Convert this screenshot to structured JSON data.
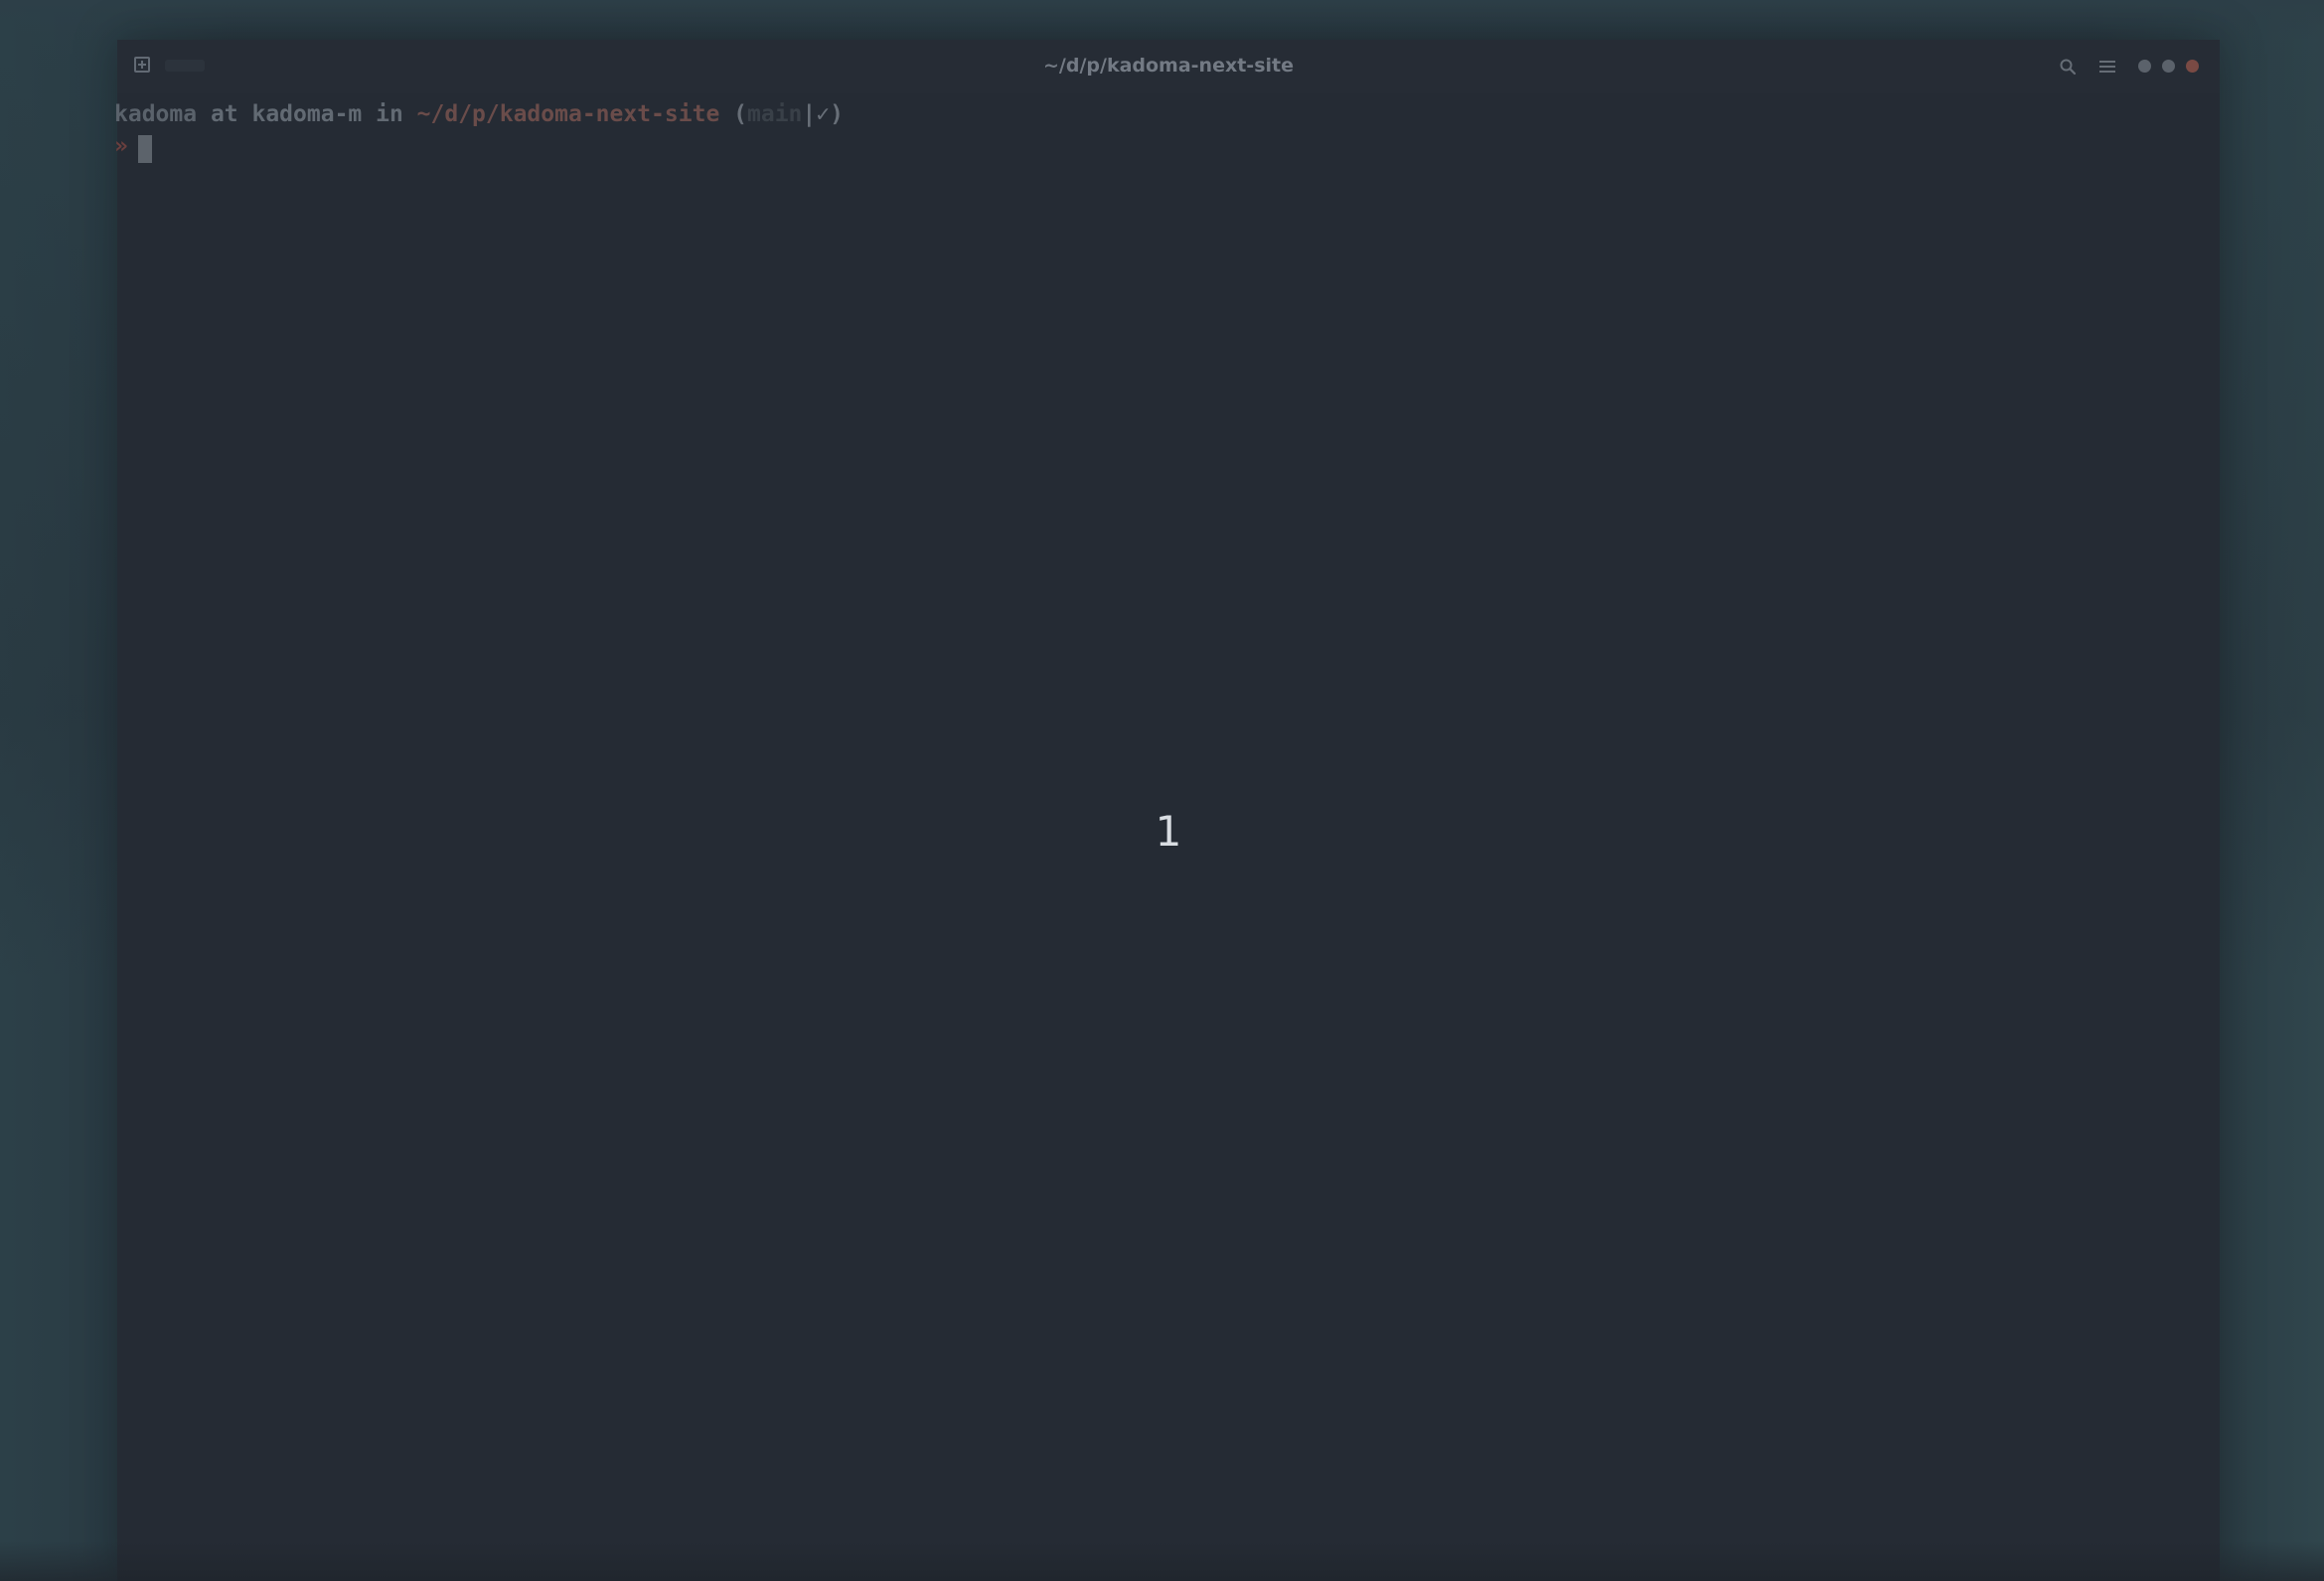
{
  "window": {
    "title": "~/d/p/kadoma-next-site",
    "controls": [
      "new-tab-icon",
      "search-icon",
      "menu-icon",
      "minimize-dot",
      "maximize-dot",
      "close-dot"
    ]
  },
  "terminal": {
    "prompt": {
      "user": "kadoma",
      "at_word": " at ",
      "host": "kadoma-m",
      "in_word": " in ",
      "path": "~/d/p/kadoma-next-site",
      "open_paren": " (",
      "branch": "main",
      "status": "|✓)"
    },
    "input": {
      "prompt_char": "»",
      "command": ""
    }
  },
  "overlay": {
    "counter": "1"
  },
  "colors": {
    "background": "#252b34",
    "path": "#6a4c4a",
    "prompt_char": "#6a3f3e",
    "close_dot": "#7a4a44"
  }
}
